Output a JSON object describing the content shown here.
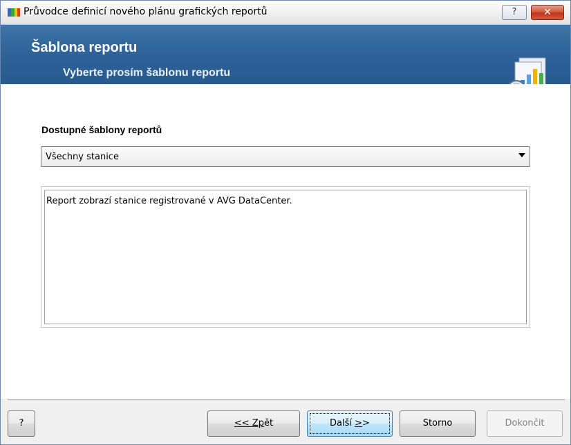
{
  "window": {
    "title": "Průvodce definicí nového plánu grafických reportů",
    "help_button": "?",
    "close_button": "✕"
  },
  "header": {
    "title": "Šablona reportu",
    "subtitle": "Vyberte prosím šablonu reportu"
  },
  "main": {
    "section_label": "Dostupné šablony reportů",
    "template_select": {
      "value": "Všechny stanice"
    },
    "description": "Report zobrazí stanice registrované v AVG DataCenter."
  },
  "footer": {
    "help_label": "?",
    "back_prefix": "<< Zp",
    "back_suffix": "ět",
    "next_prefix": "Další ",
    "next_hotkey": ">",
    "next_suffix": ">",
    "cancel_label": "Storno",
    "finish_label": "Dokončit"
  },
  "colors": {
    "header_blue": "#2f6399",
    "close_red": "#c7432a"
  }
}
